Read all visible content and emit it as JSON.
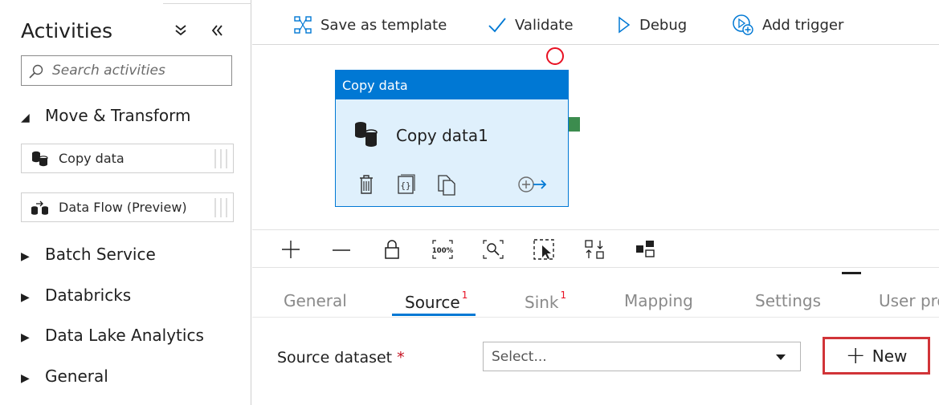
{
  "sidebar": {
    "title": "Activities",
    "search_placeholder": "Search activities",
    "categories": [
      {
        "label": "Move & Transform",
        "expanded": true
      },
      {
        "label": "Batch Service",
        "expanded": false
      },
      {
        "label": "Databricks",
        "expanded": false
      },
      {
        "label": "Data Lake Analytics",
        "expanded": false
      },
      {
        "label": "General",
        "expanded": false
      }
    ],
    "activities": [
      {
        "label": "Copy data",
        "icon": "copy-data-icon"
      },
      {
        "label": "Data Flow (Preview)",
        "icon": "data-flow-icon"
      }
    ]
  },
  "toolbar": {
    "save_template": "Save as template",
    "validate": "Validate",
    "debug": "Debug",
    "add_trigger": "Add trigger"
  },
  "canvas": {
    "activity": {
      "header": "Copy data",
      "name": "Copy data1"
    },
    "tools": [
      "zoom-in-icon",
      "zoom-out-icon",
      "lock-icon",
      "zoom-100-icon",
      "zoom-fit-icon",
      "multi-select-icon",
      "auto-align-icon",
      "layout-icon"
    ]
  },
  "properties": {
    "tabs": [
      {
        "label": "General",
        "badge": ""
      },
      {
        "label": "Source",
        "badge": "1"
      },
      {
        "label": "Sink",
        "badge": "1"
      },
      {
        "label": "Mapping",
        "badge": ""
      },
      {
        "label": "Settings",
        "badge": ""
      },
      {
        "label": "User pro",
        "badge": ""
      }
    ],
    "active_tab": "Source",
    "source_dataset_label": "Source dataset",
    "required_marker": "*",
    "select_value": "Select...",
    "new_button": "New"
  },
  "colors": {
    "accent": "#0078d4",
    "activity_bg": "#dff0fc",
    "error_red": "#e81123",
    "success_green": "#3c8c4e",
    "highlight_border": "#d13438"
  }
}
